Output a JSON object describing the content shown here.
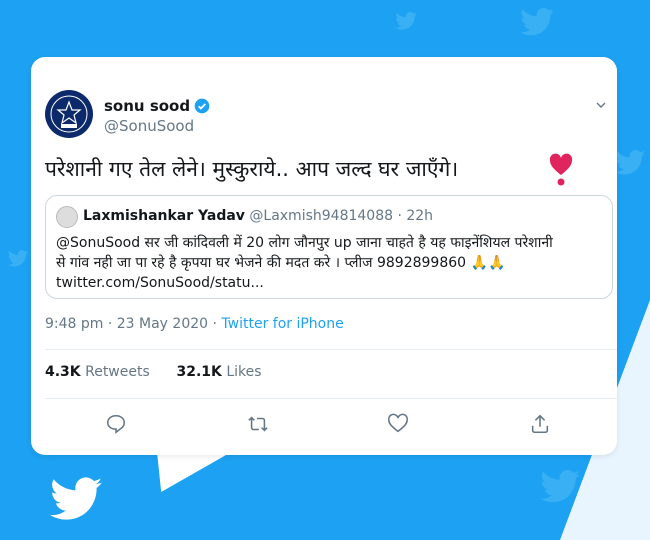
{
  "author": {
    "name": "sonu sood",
    "handle": "@SonuSood"
  },
  "tweet": {
    "text": "परेशानी गए तेल लेने। मुस्कुराये.. आप जल्द घर जाएँगे।"
  },
  "quote": {
    "name": "Laxmishankar Yadav",
    "handle": "@Laxmish94814088",
    "time": "· 22h",
    "lines": [
      "@SonuSood सर जी कांदिवली में 20 लोग जौनपुर up जाना चाहते है यह फाइनेंशियल परेशानी",
      "से गांव नही जा पा रहे है कृपया घर भेजने की मदत करे । प्लीज 9892899860 🙏🙏",
      "twitter.com/SonuSood/statu..."
    ]
  },
  "meta": {
    "time": "9:48 pm · 23 May 2020 · ",
    "source": "Twitter for iPhone"
  },
  "stats": {
    "retweets_count": "4.3K",
    "retweets_label": " Retweets",
    "likes_count": "32.1K",
    "likes_label": " Likes"
  },
  "icons": {
    "reply": "reply-icon",
    "retweet": "retweet-icon",
    "like": "like-icon",
    "share": "share-icon",
    "menu": "chevron-down-icon",
    "verified": "verified-icon",
    "heart_emoji": "red-heart-icon",
    "logo": "twitter-bird-icon"
  },
  "colors": {
    "brand": "#1da1f2",
    "text": "#14171a",
    "muted": "#657786",
    "heart": "#e0245e"
  }
}
